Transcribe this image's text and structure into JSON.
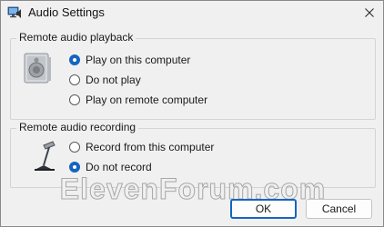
{
  "window": {
    "title": "Audio Settings",
    "icon": "audio-settings-app-icon",
    "close_icon": "close-icon"
  },
  "playback": {
    "title": "Remote audio playback",
    "icon": "speaker-icon",
    "options": [
      {
        "label": "Play on this computer",
        "checked": true
      },
      {
        "label": "Do not play",
        "checked": false
      },
      {
        "label": "Play on remote computer",
        "checked": false
      }
    ]
  },
  "recording": {
    "title": "Remote audio recording",
    "icon": "microphone-icon",
    "options": [
      {
        "label": "Record from this computer",
        "checked": false
      },
      {
        "label": "Do not record",
        "checked": true
      }
    ]
  },
  "watermark": "ElevenForum.com",
  "buttons": {
    "ok": "OK",
    "cancel": "Cancel"
  },
  "colors": {
    "accent": "#1565c0",
    "background": "#f0f0f0"
  }
}
